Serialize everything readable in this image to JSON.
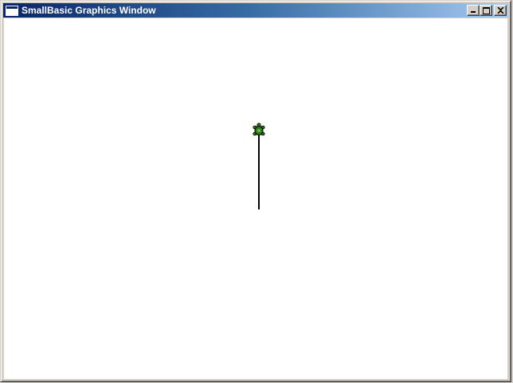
{
  "window": {
    "title": "SmallBasic Graphics Window",
    "icon": "window-app-icon",
    "caption_buttons": [
      "minimize",
      "maximize",
      "close"
    ]
  },
  "canvas": {
    "background": "#ffffff",
    "turtle": {
      "icon": "turtle-icon",
      "shell_color": "#2e7d1b",
      "outline_color": "#000000"
    },
    "pen_line_color": "#000000"
  }
}
